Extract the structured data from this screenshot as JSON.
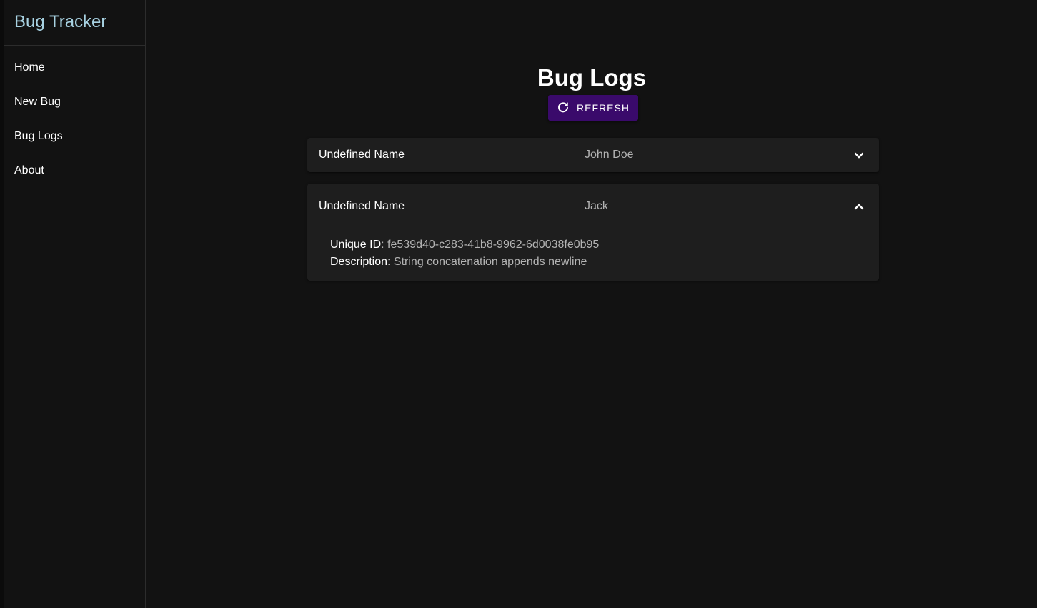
{
  "app": {
    "title": "Bug Tracker",
    "colors": {
      "accent": "#3a0a6b",
      "brand_text": "#a8d2e2",
      "background": "#121212",
      "card": "#1e1e1e"
    }
  },
  "sidebar": {
    "items": [
      {
        "label": "Home"
      },
      {
        "label": "New Bug"
      },
      {
        "label": "Bug Logs"
      },
      {
        "label": "About"
      }
    ]
  },
  "main": {
    "title": "Bug Logs",
    "refresh_label": "REFRESH",
    "refresh_icon": "refresh-icon",
    "bugs": [
      {
        "name": "Undefined Name",
        "reporter": "John Doe",
        "expanded": false,
        "chevron_icon": "chevron-down-icon"
      },
      {
        "name": "Undefined Name",
        "reporter": "Jack",
        "expanded": true,
        "chevron_icon": "chevron-up-icon",
        "id_label": "Unique ID",
        "id_value": "fe539d40-c283-41b8-9962-6d0038fe0b95",
        "desc_label": "Description",
        "desc_value": "String concatenation appends newline"
      }
    ]
  }
}
